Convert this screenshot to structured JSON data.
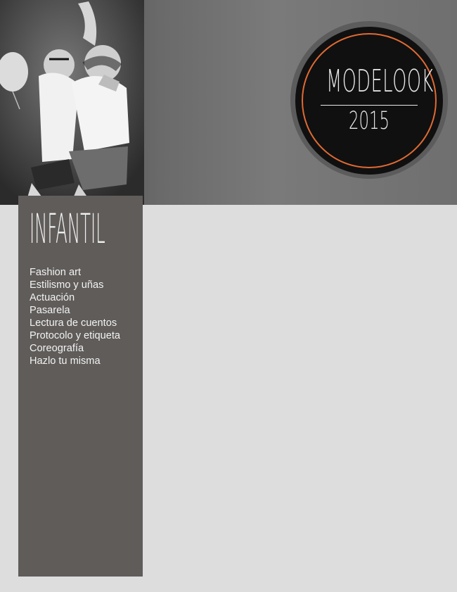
{
  "brand": {
    "title": "MODELOOK",
    "year": "2015"
  },
  "section": {
    "title": "INFANTIL",
    "items": [
      "Fashion art",
      "Estilismo y uñas",
      "Actuación",
      "Pasarela",
      "Lectura de cuentos",
      "Protocolo y etiqueta",
      "Coreografía",
      "Hazlo tu misma"
    ]
  },
  "colors": {
    "page_background": "#dedddd",
    "panel_background": "#5f5c5a",
    "badge_black": "#101010",
    "badge_ring": "#e06a33",
    "header_gray": "#707070"
  },
  "photo": {
    "icon": "photo-icon"
  }
}
